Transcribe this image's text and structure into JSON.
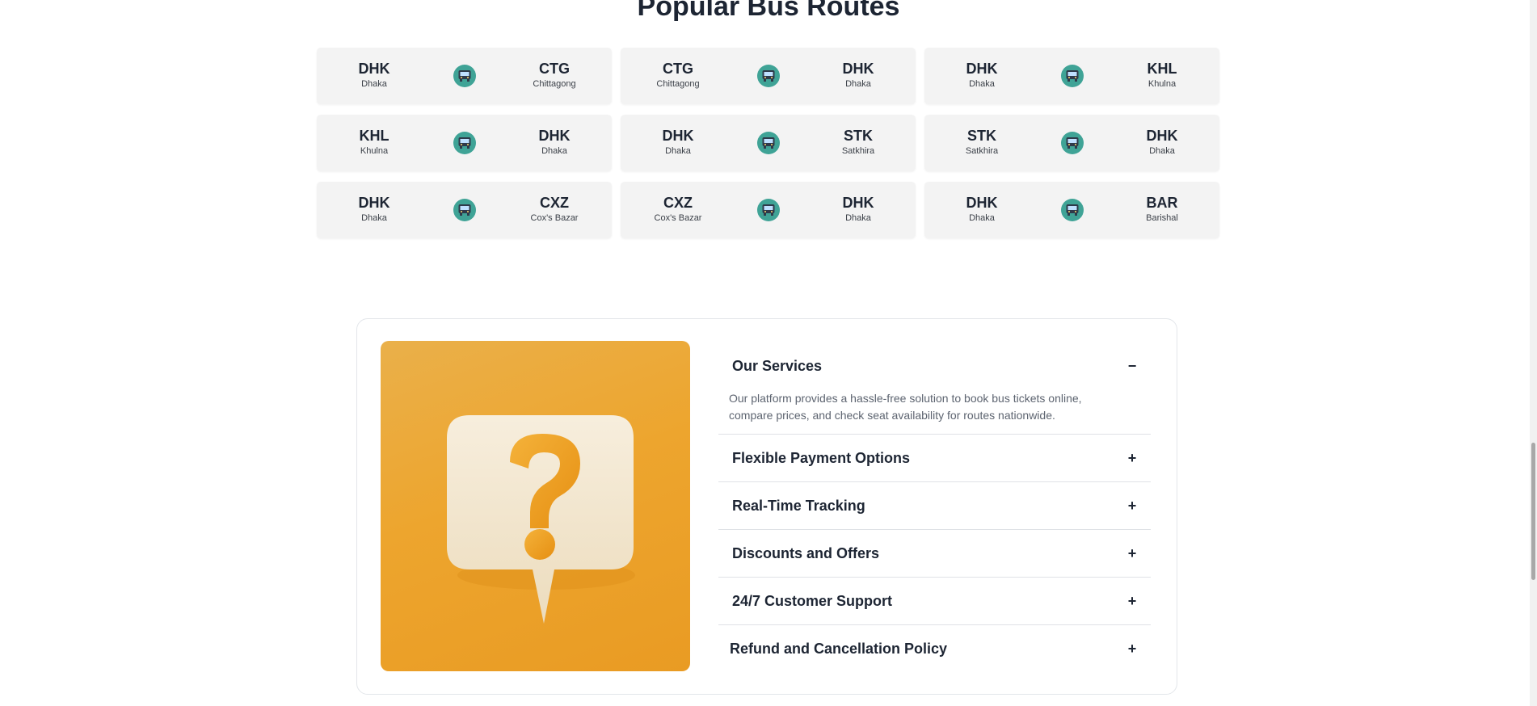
{
  "section": {
    "title": "Popular Bus Routes"
  },
  "routes": [
    {
      "from_code": "DHK",
      "from_name": "Dhaka",
      "to_code": "CTG",
      "to_name": "Chittagong"
    },
    {
      "from_code": "CTG",
      "from_name": "Chittagong",
      "to_code": "DHK",
      "to_name": "Dhaka"
    },
    {
      "from_code": "DHK",
      "from_name": "Dhaka",
      "to_code": "KHL",
      "to_name": "Khulna"
    },
    {
      "from_code": "KHL",
      "from_name": "Khulna",
      "to_code": "DHK",
      "to_name": "Dhaka"
    },
    {
      "from_code": "DHK",
      "from_name": "Dhaka",
      "to_code": "STK",
      "to_name": "Satkhira"
    },
    {
      "from_code": "STK",
      "from_name": "Satkhira",
      "to_code": "DHK",
      "to_name": "Dhaka"
    },
    {
      "from_code": "DHK",
      "from_name": "Dhaka",
      "to_code": "CXZ",
      "to_name": "Cox's Bazar"
    },
    {
      "from_code": "CXZ",
      "from_name": "Cox's Bazar",
      "to_code": "DHK",
      "to_name": "Dhaka"
    },
    {
      "from_code": "DHK",
      "from_name": "Dhaka",
      "to_code": "BAR",
      "to_name": "Barishal"
    }
  ],
  "icons": {
    "route": "bus-icon",
    "faq_illustration": "question-bubble-icon",
    "collapse": "minus-icon",
    "expand": "plus-icon"
  },
  "colors": {
    "accent": "#3fa396",
    "image_bg": "#eda52e",
    "card_bg": "#f3f3f3"
  },
  "faq": [
    {
      "question": "Our Services",
      "open": true,
      "toggle": "−",
      "answer": "Our platform provides a hassle-free solution to book bus tickets online, compare prices, and check seat availability for routes nationwide."
    },
    {
      "question": "Flexible Payment Options",
      "open": false,
      "toggle": "+"
    },
    {
      "question": "Real-Time Tracking",
      "open": false,
      "toggle": "+"
    },
    {
      "question": "Discounts and Offers",
      "open": false,
      "toggle": "+"
    },
    {
      "question": "24/7 Customer Support",
      "open": false,
      "toggle": "+"
    },
    {
      "question": "Refund and Cancellation Policy",
      "open": false,
      "toggle": "+"
    }
  ]
}
